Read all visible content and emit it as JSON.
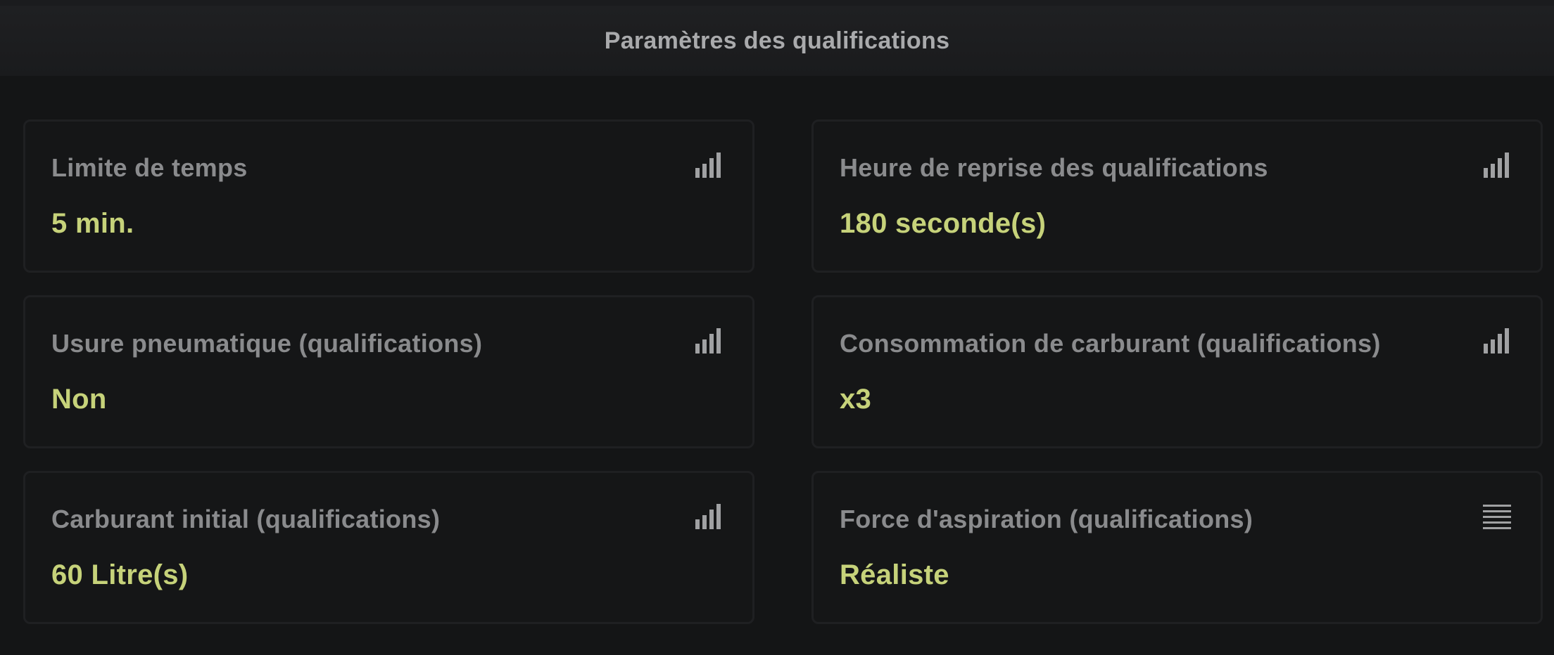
{
  "header": {
    "title": "Paramètres des qualifications"
  },
  "settings": [
    {
      "label": "Limite de temps",
      "value": "5 min.",
      "icon": "signal-bars-icon"
    },
    {
      "label": "Heure de reprise des qualifications",
      "value": "180 seconde(s)",
      "icon": "signal-bars-icon"
    },
    {
      "label": "Usure pneumatique (qualifications)",
      "value": "Non",
      "icon": "signal-bars-icon"
    },
    {
      "label": "Consommation de carburant (qualifications)",
      "value": "x3",
      "icon": "signal-bars-icon"
    },
    {
      "label": "Carburant initial (qualifications)",
      "value": "60 Litre(s)",
      "icon": "signal-bars-icon"
    },
    {
      "label": "Force d'aspiration (qualifications)",
      "value": "Réaliste",
      "icon": "list-lines-icon"
    }
  ],
  "colors": {
    "background": "#141516",
    "label": "#8a8b8d",
    "value": "#c6d27a",
    "icon": "#a0a1a3"
  }
}
